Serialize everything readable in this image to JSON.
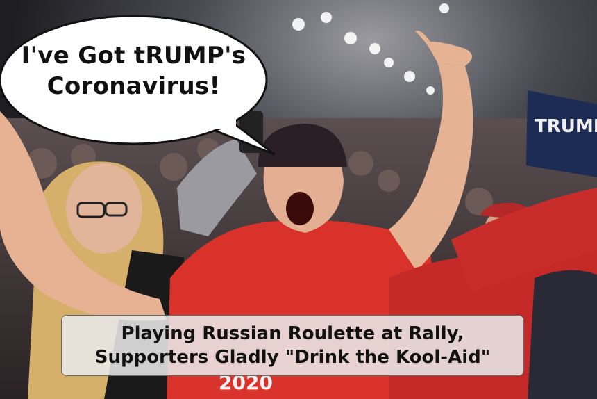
{
  "speech_bubble": {
    "line1": "I've Got tRUMP's",
    "line2": "Coronavirus!"
  },
  "caption": {
    "line1": "Playing Russian Roulette at Rally,",
    "line2": "Supporters Gladly \"Drink the Kool-Aid\""
  },
  "background_signs": {
    "banner_text": "TRUMP",
    "shirt_text": "2020"
  },
  "colors": {
    "shirt_red": "#d8322a",
    "arena_dark": "#2a2a2e",
    "bubble_fill": "#ffffff",
    "caption_bg": "#e8e8e8"
  }
}
